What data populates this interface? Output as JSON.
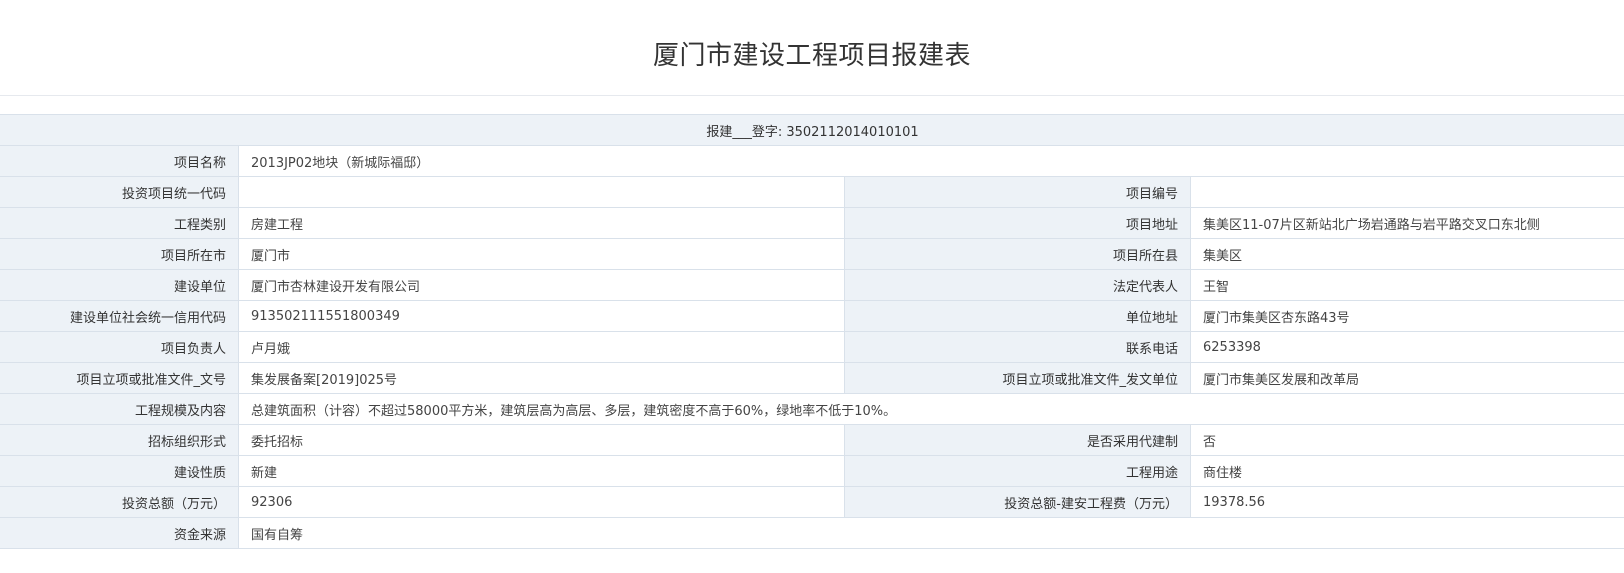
{
  "title": "厦门市建设工程项目报建表",
  "registration": {
    "label": "报建___登字:",
    "value": "3502112014010101"
  },
  "rows": [
    {
      "l1": "项目名称",
      "v1": "2013JP02地块（新城际福邸）"
    },
    {
      "l1": "投资项目统一代码",
      "v1": "",
      "l2": "项目编号",
      "v2": ""
    },
    {
      "l1": "工程类别",
      "v1": "房建工程",
      "l2": "项目地址",
      "v2": "集美区11-07片区新站北广场岩通路与岩平路交叉口东北侧"
    },
    {
      "l1": "项目所在市",
      "v1": "厦门市",
      "l2": "项目所在县",
      "v2": "集美区"
    },
    {
      "l1": "建设单位",
      "v1": "厦门市杏林建设开发有限公司",
      "l2": "法定代表人",
      "v2": "王智"
    },
    {
      "l1": "建设单位社会统一信用代码",
      "v1": "913502111551800349",
      "l2": "单位地址",
      "v2": "厦门市集美区杏东路43号"
    },
    {
      "l1": "项目负责人",
      "v1": "卢月娥",
      "l2": "联系电话",
      "v2": "6253398"
    },
    {
      "l1": "项目立项或批准文件_文号",
      "v1": "集发展备案[2019]025号",
      "l2": "项目立项或批准文件_发文单位",
      "v2": "厦门市集美区发展和改革局"
    },
    {
      "l1": "工程规模及内容",
      "v1": "总建筑面积（计容）不超过58000平方米，建筑层高为高层、多层，建筑密度不高于60%，绿地率不低于10%。"
    },
    {
      "l1": "招标组织形式",
      "v1": "委托招标",
      "l2": "是否采用代建制",
      "v2": "否"
    },
    {
      "l1": "建设性质",
      "v1": "新建",
      "l2": "工程用途",
      "v2": "商住楼"
    },
    {
      "l1": "投资总额（万元）",
      "v1": "92306",
      "l2": "投资总额-建安工程费（万元）",
      "v2": "19378.56"
    },
    {
      "l1": "资金来源",
      "v1": "国有自筹"
    }
  ]
}
